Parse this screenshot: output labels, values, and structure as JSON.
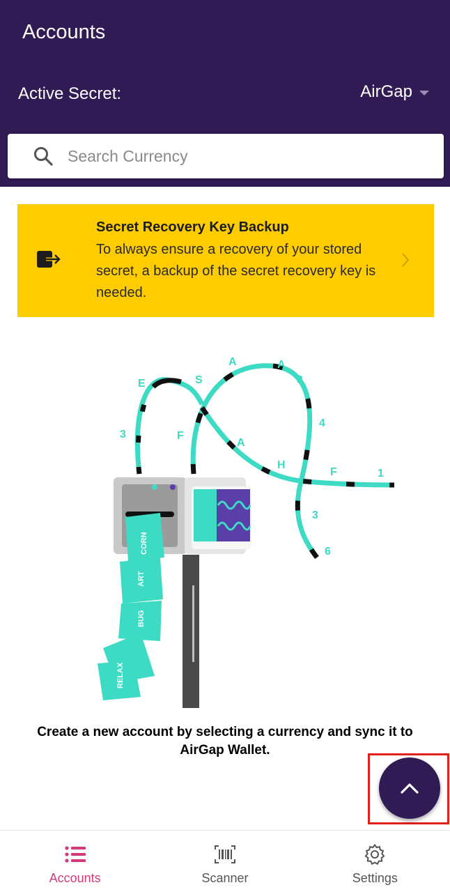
{
  "header": {
    "title": "Accounts",
    "active_secret_label": "Active Secret:",
    "active_secret_value": "AirGap"
  },
  "search": {
    "placeholder": "Search Currency",
    "value": ""
  },
  "banner": {
    "title": "Secret Recovery Key Backup",
    "text": "To always ensure a recovery of your stored secret, a backup of the secret recovery key is needed.",
    "icon": "exit-to-app-icon"
  },
  "empty_state": {
    "message": "Create a new account by selecting a currency and sync it to AirGap Wallet."
  },
  "fab": {
    "icon": "chevron-up-icon"
  },
  "tabs": [
    {
      "label": "Accounts",
      "icon": "list-icon",
      "active": true
    },
    {
      "label": "Scanner",
      "icon": "barcode-icon",
      "active": false
    },
    {
      "label": "Settings",
      "icon": "gear-icon",
      "active": false
    }
  ],
  "colors": {
    "primary": "#311b54",
    "banner": "#ffcc00",
    "accent": "#d23a7a",
    "teal": "#3ddbc3"
  }
}
